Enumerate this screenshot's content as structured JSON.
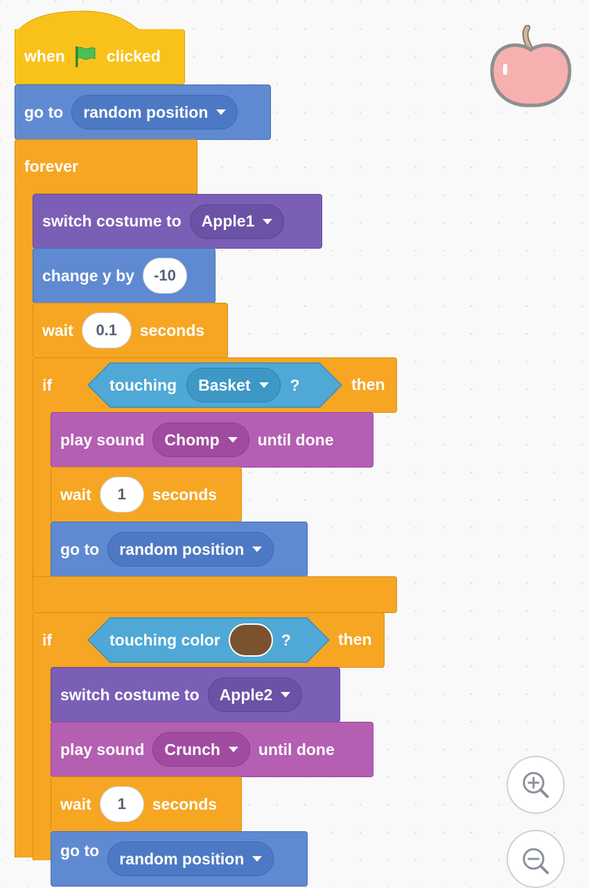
{
  "script": {
    "hat": {
      "before": "when",
      "flag_icon": "green-flag-icon",
      "after": "clicked"
    },
    "goto1": {
      "label": "go to",
      "dropdown": "random position"
    },
    "forever": {
      "label": "forever"
    },
    "costume1": {
      "label": "switch costume to",
      "dropdown": "Apple1"
    },
    "changey": {
      "label": "change y by",
      "value": "-10"
    },
    "wait1": {
      "before": "wait",
      "value": "0.1",
      "after": "seconds"
    },
    "if1": {
      "label": "if",
      "then": "then",
      "condition": {
        "label": "touching",
        "dropdown": "Basket",
        "suffix": "?"
      }
    },
    "sound1": {
      "before": "play sound",
      "dropdown": "Chomp",
      "after": "until done"
    },
    "wait2": {
      "before": "wait",
      "value": "1",
      "after": "seconds"
    },
    "goto2": {
      "label": "go to",
      "dropdown": "random position"
    },
    "if2": {
      "label": "if",
      "then": "then",
      "condition": {
        "label": "touching color",
        "swatch_color": "#7a5230",
        "suffix": "?"
      }
    },
    "costume2": {
      "label": "switch costume to",
      "dropdown": "Apple2"
    },
    "sound2": {
      "before": "play sound",
      "dropdown": "Crunch",
      "after": "until done"
    },
    "wait3": {
      "before": "wait",
      "value": "1",
      "after": "seconds"
    },
    "goto3": {
      "label": "go to",
      "dropdown": "random position"
    }
  },
  "sprite": {
    "icon": "apple-sprite-icon"
  },
  "controls": {
    "zoom_in_icon": "zoom-in-icon",
    "zoom_out_icon": "zoom-out-icon"
  },
  "colors": {
    "events": "#f9c21a",
    "motion": "#5f8ad1",
    "looks": "#7b5fb6",
    "sound": "#b45fb2",
    "control": "#f6a623",
    "sensing": "#4fa8d6"
  }
}
